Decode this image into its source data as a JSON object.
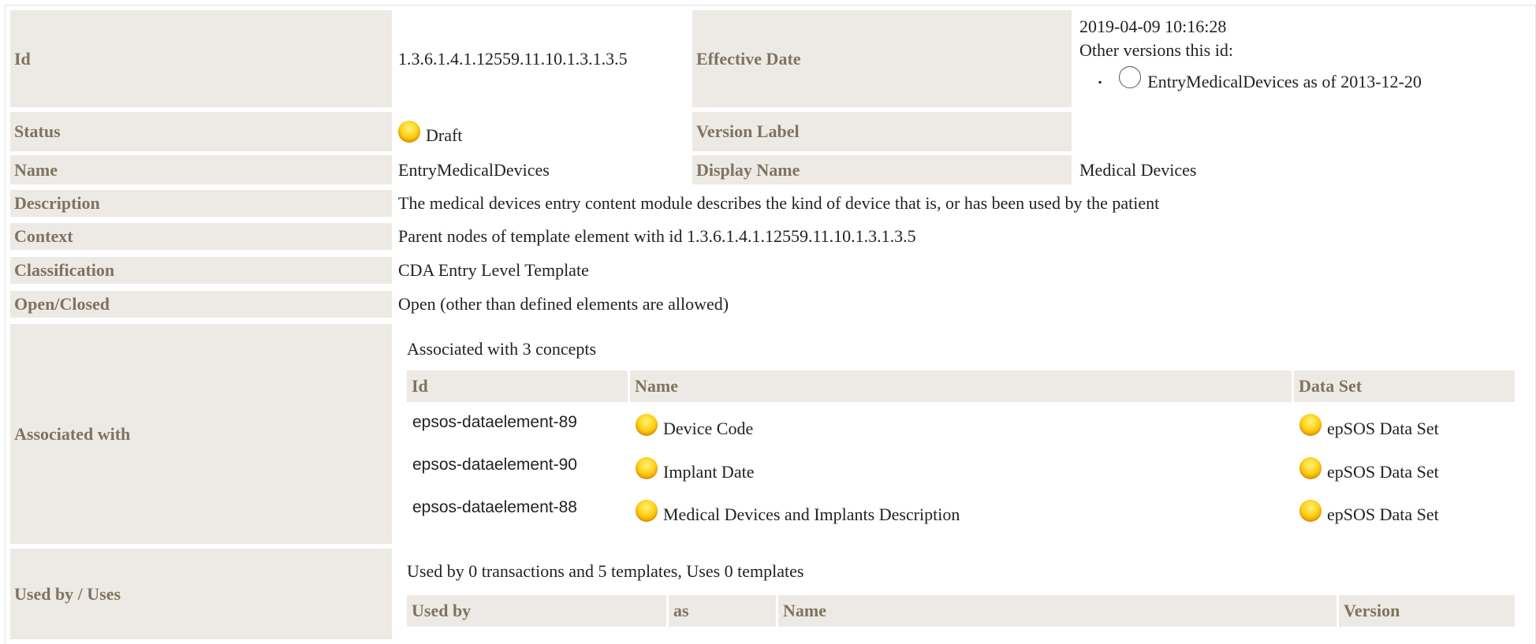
{
  "template": {
    "id_label": "Id",
    "id_value": "1.3.6.1.4.1.12559.11.10.1.3.1.3.5",
    "effective_date_label": "Effective Date",
    "effective_date_value": "2019-04-09 10:16:28",
    "other_versions_label": "Other versions this id:",
    "other_versions": [
      {
        "bullet": "▪",
        "text": "EntryMedicalDevices as of 2013-12-20"
      }
    ],
    "status_label": "Status",
    "status_value": "Draft",
    "version_label_label": "Version Label",
    "version_label_value": "",
    "name_label": "Name",
    "name_value": "EntryMedicalDevices",
    "display_name_label": "Display Name",
    "display_name_value": "Medical Devices",
    "description_label": "Description",
    "description_value": "The medical devices entry content module describes the kind of device that is, or has been used by the patient",
    "context_label": "Context",
    "context_value": "Parent nodes of template element with id 1.3.6.1.4.1.12559.11.10.1.3.1.3.5",
    "classification_label": "Classification",
    "classification_value": "CDA Entry Level Template",
    "open_closed_label": "Open/Closed",
    "open_closed_value": "Open (other than defined elements are allowed)",
    "associated_label": "Associated with",
    "associated_summary": "Associated with 3 concepts",
    "associated_headers": [
      "Id",
      "Name",
      "Data Set"
    ],
    "associated_rows": [
      {
        "id": "epsos-dataelement-89",
        "name": "Device Code",
        "dataset": "epSOS Data Set"
      },
      {
        "id": "epsos-dataelement-90",
        "name": "Implant Date",
        "dataset": "epSOS Data Set"
      },
      {
        "id": "epsos-dataelement-88",
        "name": "Medical Devices and Implants Description",
        "dataset": "epSOS Data Set"
      }
    ],
    "usedby_label": "Used by / Uses",
    "usedby_summary": "Used by 0 transactions and 5 templates, Uses 0 templates",
    "usedby_headers": [
      "Used by",
      "as",
      "Name",
      "Version"
    ]
  },
  "colors": {
    "label_bg": "#edeae6",
    "label_text": "#7f735f",
    "status_draft": "#ffd21a"
  }
}
